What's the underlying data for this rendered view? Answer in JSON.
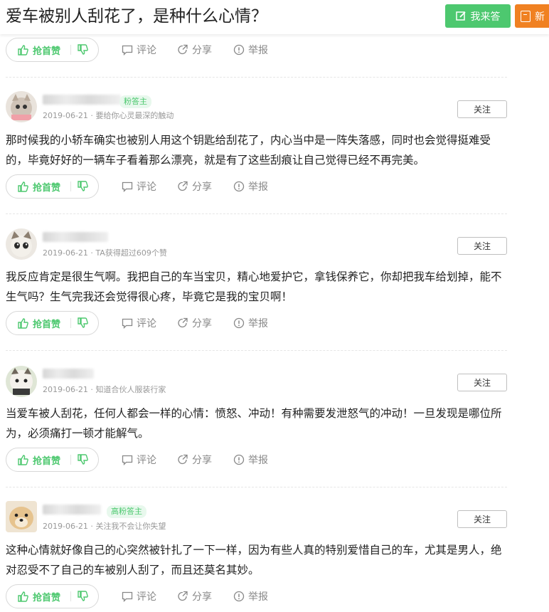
{
  "header": {
    "title": "爱车被别人刮花了，是种什么心情？",
    "answer_button": "我来答",
    "new_button": "新"
  },
  "actions": {
    "like": "抢首赞",
    "comment": "评论",
    "share": "分享",
    "report": "举报"
  },
  "colors": {
    "accent_green": "#4dc86f",
    "orange": "#f08122"
  },
  "answers": [
    {
      "badge": "粉答主",
      "date": "2019-06-21",
      "tagline": "要给你心灵最深的触动",
      "follow": "关注",
      "avatar": "cat-avatar-icon",
      "text": "那时候我的小轿车确实也被别人用这个钥匙给刮花了，内心当中是一阵失落感，同时也会觉得挺难受的，毕竟好好的一辆车子看着那么漂亮，就是有了这些刮痕让自己觉得已经不再完美。"
    },
    {
      "badge": "",
      "date": "2019-06-21",
      "tagline": "TA获得超过609个赞",
      "follow": "关注",
      "avatar": "cat-avatar-icon",
      "text": "我反应肯定是很生气啊。我把自己的车当宝贝，精心地爱护它，拿钱保养它，你却把我车给划掉，能不生气吗？生气完我还会觉得很心疼，毕竟它是我的宝贝啊！"
    },
    {
      "badge": "",
      "date": "2019-06-21",
      "tagline": "知道合伙人服装行家",
      "follow": "关注",
      "avatar": "cat-avatar-icon",
      "text": "当爱车被人刮花，任何人都会一样的心情：愤怒、冲动！有种需要发泄怒气的冲动！一旦发现是哪位所为，必须痛打一顿才能解气。"
    },
    {
      "badge": "高粉答主",
      "date": "2019-06-21",
      "tagline": "关注我不会让你失望",
      "follow": "关注",
      "avatar": "dog-avatar-icon",
      "text": "这种心情就好像自己的心突然被针扎了一下一样，因为有些人真的特别爱惜自己的车，尤其是男人，绝对忍受不了自己的车被别人刮了，而且还莫名其妙。"
    }
  ]
}
